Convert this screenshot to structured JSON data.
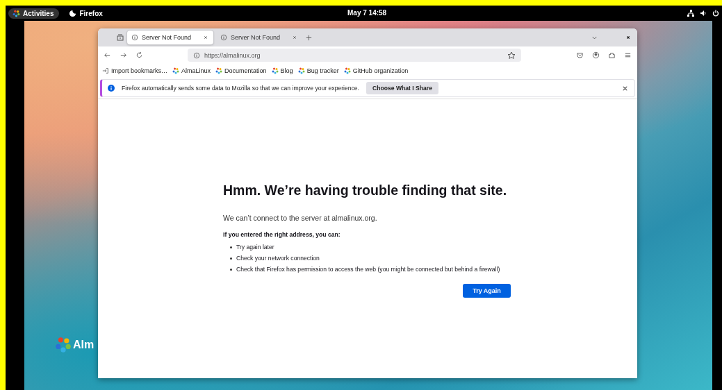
{
  "top_bar": {
    "activities": "Activities",
    "app": "Firefox",
    "clock": "May 7 14:58"
  },
  "desktop": {
    "logo_text": "Alm"
  },
  "browser": {
    "tabs": [
      {
        "title": "Server Not Found",
        "selected": true
      },
      {
        "title": "Server Not Found",
        "selected": false
      }
    ],
    "url": "https://almalinux.org",
    "bookmarks": [
      {
        "label": "Import bookmarks…",
        "kind": "import"
      },
      {
        "label": "AlmaLinux",
        "kind": "site"
      },
      {
        "label": "Documentation",
        "kind": "site"
      },
      {
        "label": "Blog",
        "kind": "site"
      },
      {
        "label": "Bug tracker",
        "kind": "site"
      },
      {
        "label": "GitHub organization",
        "kind": "site"
      }
    ],
    "notification": {
      "text": "Firefox automatically sends some data to Mozilla so that we can improve your experience.",
      "button": "Choose What I Share"
    },
    "page": {
      "heading": "Hmm. We’re having trouble finding that site.",
      "message": "We can’t connect to the server at almalinux.org.",
      "subheading": "If you entered the right address, you can:",
      "suggestions": [
        "Try again later",
        "Check your network connection",
        "Check that Firefox has permission to access the web (you might be connected but behind a firewall)"
      ],
      "button": "Try Again"
    }
  }
}
